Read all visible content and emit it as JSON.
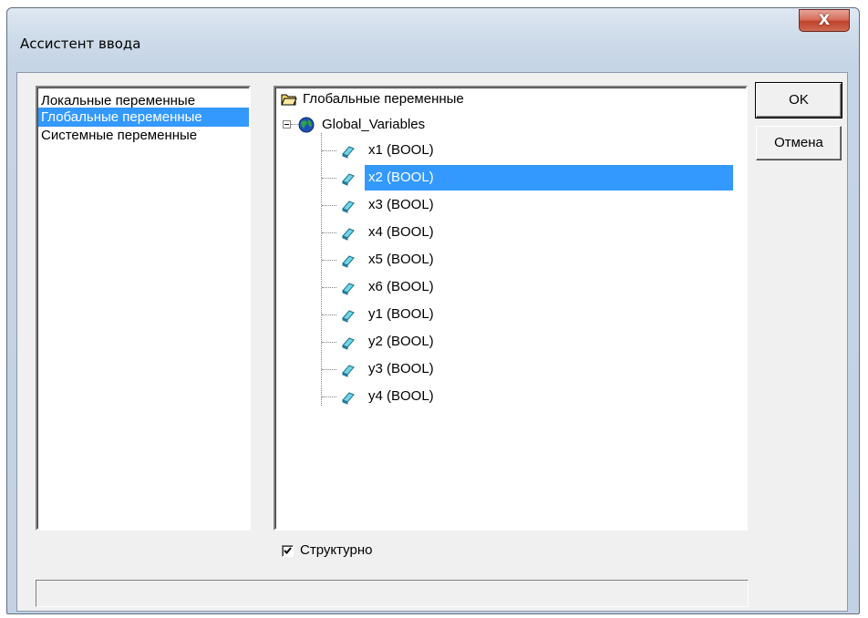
{
  "window": {
    "title": "Ассистент ввода",
    "close_label": "X"
  },
  "left_list": {
    "items": [
      {
        "label": "Локальные переменные",
        "selected": false
      },
      {
        "label": "Глобальные переменные",
        "selected": true
      },
      {
        "label": "Системные переменные",
        "selected": false
      }
    ]
  },
  "tree": {
    "root_label": "Глобальные переменные",
    "group_label": "Global_Variables",
    "variables": [
      {
        "label": "x1 (BOOL)",
        "selected": false
      },
      {
        "label": "x2 (BOOL)",
        "selected": true
      },
      {
        "label": "x3 (BOOL)",
        "selected": false
      },
      {
        "label": "x4 (BOOL)",
        "selected": false
      },
      {
        "label": "x5 (BOOL)",
        "selected": false
      },
      {
        "label": "x6 (BOOL)",
        "selected": false
      },
      {
        "label": "y1 (BOOL)",
        "selected": false
      },
      {
        "label": "y2 (BOOL)",
        "selected": false
      },
      {
        "label": "y3 (BOOL)",
        "selected": false
      },
      {
        "label": "y4 (BOOL)",
        "selected": false
      }
    ]
  },
  "buttons": {
    "ok_label": "OK",
    "cancel_label": "Отмена"
  },
  "structured": {
    "label": "Структурно",
    "checked": true
  },
  "status_text": "",
  "icons": {
    "folder": "folder-open-icon",
    "globe": "globe-icon",
    "variable": "variable-icon"
  },
  "colors": {
    "selection": "#3399ff",
    "close_button": "#c7432e"
  }
}
